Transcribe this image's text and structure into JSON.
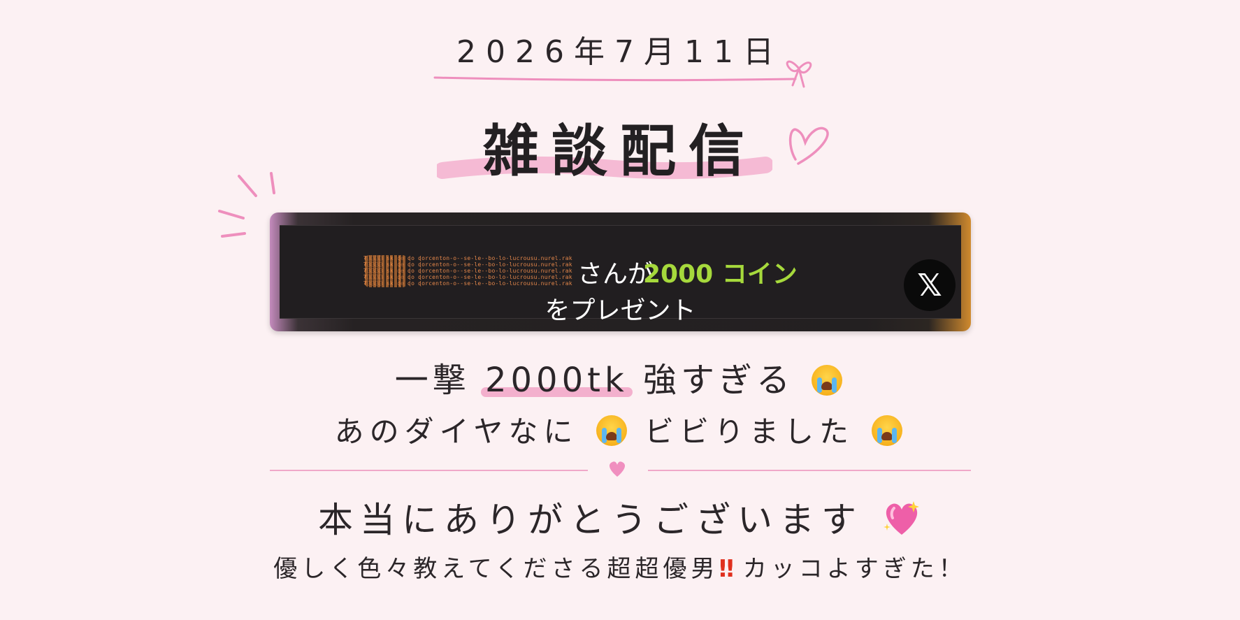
{
  "header": {
    "date": "2026年7月11日",
    "title": "雑談配信"
  },
  "banner": {
    "username_glitch": "₮₿₿₿₿ sk ɖe ɖo ɖorcenton-o--se-le--bo-lo-lucrousu.nurel.rakrslceahkn ko yo kc\n₮₿₿₿₿ sk ɖe ɖo ɖorcenton-o--se-le--bo-lo-lucrousu.nurel.rakrslceahkn ko yo kc\n₮₿₿₿₿ sk ɖe ɖo ɖorcenton-o--se-le--bo-lo-lucrousu.nurel.rakrslceahkn ko yo kc\n₮₿₿₿₿ sk ɖe ɖo ɖorcenton-o--se-le--bo-lo-lucrousu.nurel.rakrslceahkn ko yo kc\n₮₿₿₿₿ sk ɖe ɖo ɖorcenton-o--se-le--bo-lo-lucrousu.nurel.rakrslceahkn ko yo kc",
    "san": "さんが",
    "coin": "2000 コイン",
    "line2": "をプレゼント",
    "x_icon": "x-logo-icon",
    "coin_color": "#a6d93c"
  },
  "message": {
    "line1_pre": "一撃",
    "line1_highlight": "2000tk",
    "line1_post": "強すぎる",
    "line2_a": "あのダイヤなに",
    "line2_b": "ビビりました",
    "line3": "本当にありがとうございます",
    "line4_a": "優しく色々教えてくださる超超優男",
    "line4_bang": "‼",
    "line4_b": "カッコよすぎた！"
  },
  "colors": {
    "background": "#fcf1f3",
    "accent_pink": "#f0a8c8"
  }
}
